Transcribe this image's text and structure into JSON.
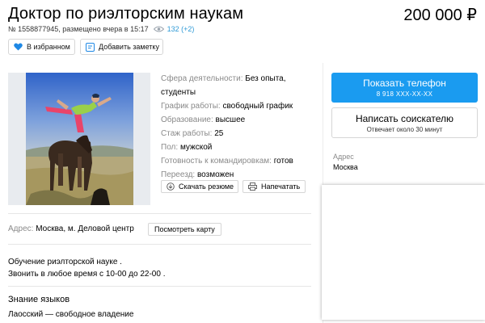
{
  "header": {
    "title": "Доктор по риэлторским наукам",
    "price": "200 000 ₽",
    "meta_text": "№ 1558877945, размещено вчера в 15:17",
    "views": "132 (+2)"
  },
  "actions": {
    "favorite_label": "В избранном",
    "note_label": "Добавить заметку"
  },
  "params": [
    {
      "key": "Сфера деятельности:",
      "value": "Без опыта, студенты"
    },
    {
      "key": "График работы:",
      "value": "свободный график"
    },
    {
      "key": "Образование:",
      "value": "высшее"
    },
    {
      "key": "Стаж работы:",
      "value": "25"
    },
    {
      "key": "Пол:",
      "value": "мужской"
    },
    {
      "key": "Готовность к командировкам:",
      "value": "готов"
    },
    {
      "key": "Переезд:",
      "value": "возможен"
    }
  ],
  "resume": {
    "download_label": "Скачать резюме",
    "print_label": "Напечатать"
  },
  "address": {
    "key": "Адрес:",
    "value": "Москва, м. Деловой центр",
    "map_button": "Посмотреть карту"
  },
  "description": {
    "line1": "Обучение риэлторской науке .",
    "line2": "Звонить в любое время с 10-00 до 22-00 ."
  },
  "languages": {
    "heading": "Знание языков",
    "value": "Лаосский — свободное владение"
  },
  "sidebar": {
    "phone_label": "Показать телефон",
    "phone_number": "8 918 XXX-XX-XX",
    "message_label": "Написать соискателю",
    "message_sub": "Отвечает около 30 минут",
    "address_key": "Адрес",
    "address_value": "Москва"
  },
  "colors": {
    "accent": "#1a9bf0",
    "views": "#2f9ad6",
    "heart": "#1e88e5"
  }
}
